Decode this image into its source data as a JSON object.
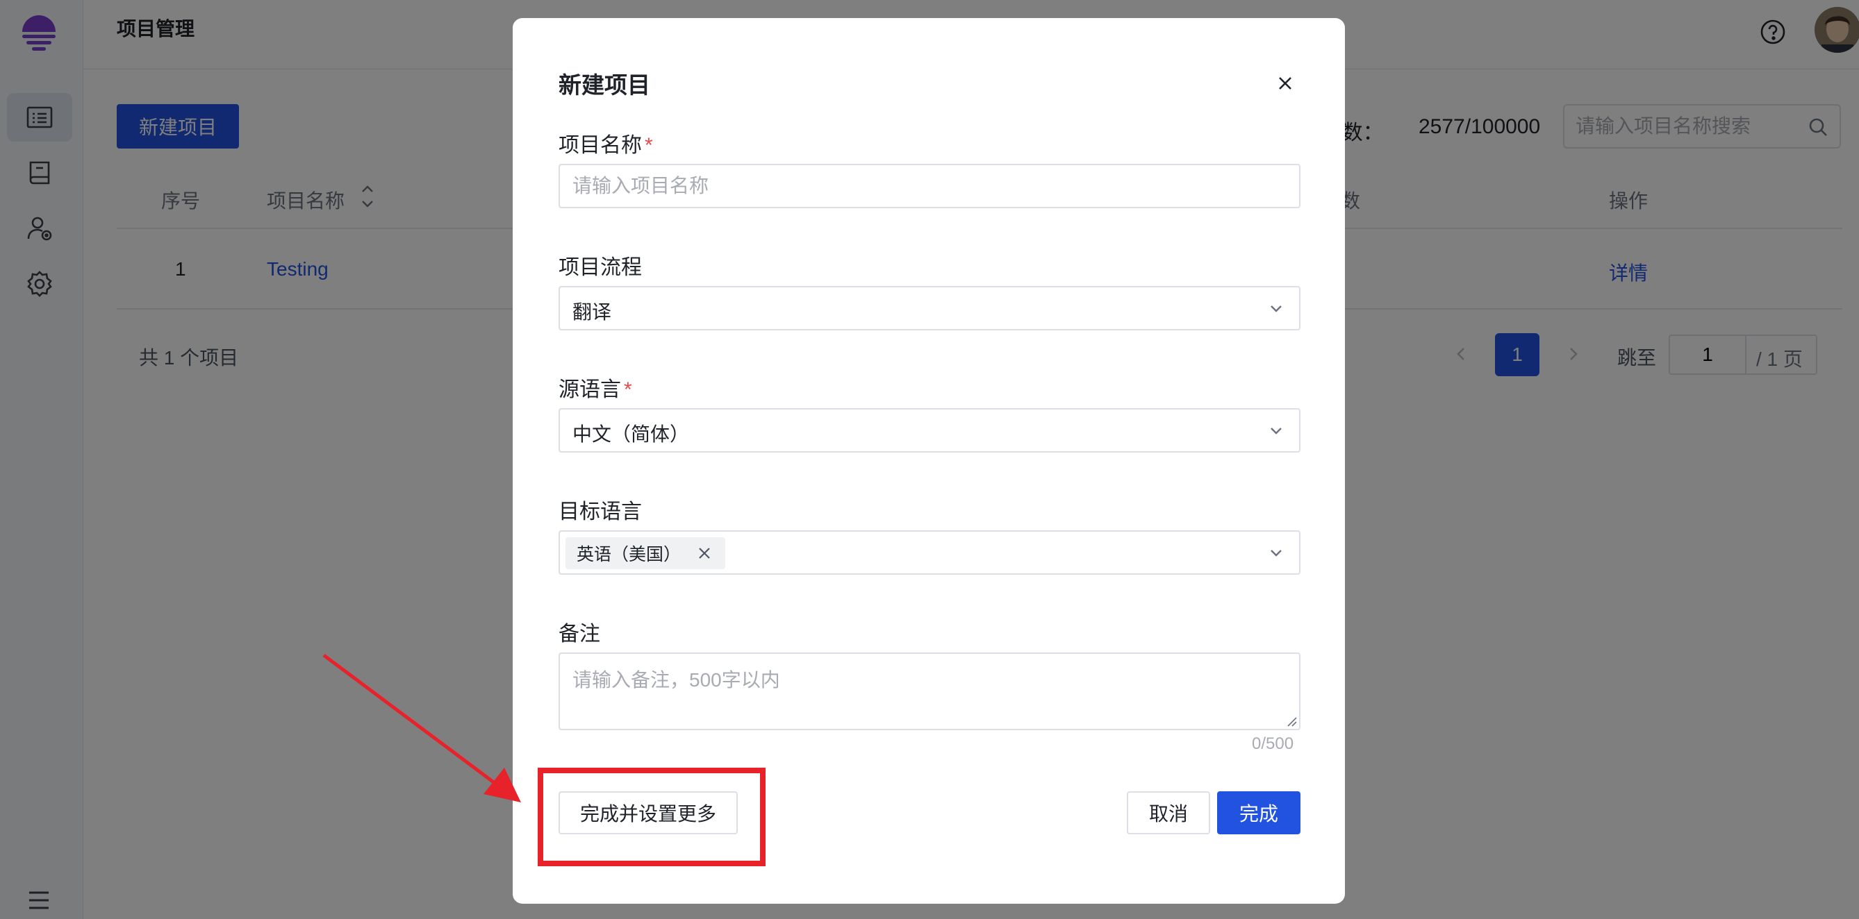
{
  "app": {
    "page_title": "项目管理"
  },
  "toolbar": {
    "new_button_label": "新建项目",
    "key_count_label": "ey数：",
    "key_count_value": "2577/100000",
    "search_placeholder": "请输入项目名称搜索"
  },
  "table": {
    "headers": {
      "index": "序号",
      "name": "项目名称",
      "count": "数",
      "actions": "操作"
    },
    "rows": [
      {
        "index": "1",
        "name": "Testing",
        "action": "详情"
      }
    ],
    "total": "共 1 个项目"
  },
  "pagination": {
    "current_page": "1",
    "jump_label": "跳至",
    "jump_value": "1",
    "jump_suffix": "/ 1 页"
  },
  "modal": {
    "title": "新建项目",
    "name_field": {
      "label": "项目名称",
      "required_mark": "*",
      "placeholder": "请输入项目名称"
    },
    "flow_field": {
      "label": "项目流程",
      "value": "翻译"
    },
    "source_field": {
      "label": "源语言",
      "required_mark": "*",
      "value": "中文（简体）"
    },
    "target_field": {
      "label": "目标语言",
      "tag": "英语（美国）"
    },
    "notes_field": {
      "label": "备注",
      "placeholder": "请输入备注，500字以内",
      "counter": "0/500"
    },
    "buttons": {
      "more": "完成并设置更多",
      "cancel": "取消",
      "ok": "完成"
    }
  },
  "colors": {
    "primary": "#2152e0",
    "annotation": "#e8222b",
    "required": "#e5484d"
  },
  "icons": {
    "logo": "brand-logo",
    "sidebar": [
      "list-icon",
      "book-icon",
      "user-settings-icon",
      "gear-icon"
    ],
    "menu": "menu-icon",
    "help": "help-icon",
    "search": "search-icon",
    "close": "close-icon",
    "chevron": "chevron-down-icon"
  }
}
